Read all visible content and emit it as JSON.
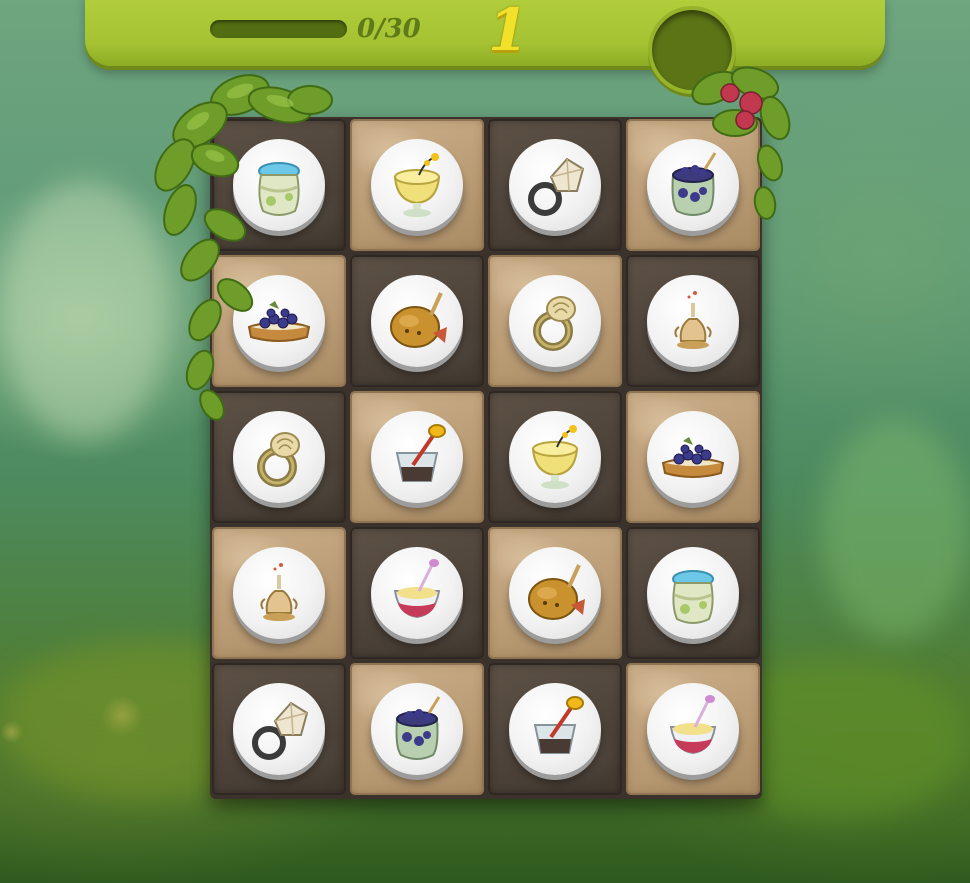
{
  "hud": {
    "progress_current": 0,
    "progress_total": 30,
    "progress_text": "0/30",
    "level": "1"
  },
  "colors": {
    "hud_green": "#a4c232",
    "level_yellow": "#f2e12a",
    "tile_light": "#b89a73",
    "tile_dark": "#4c4239"
  },
  "board": {
    "columns": 4,
    "rows": 5,
    "tiles": [
      {
        "row": 0,
        "col": 0,
        "shade": "dark",
        "item": "blue-lidded-jar"
      },
      {
        "row": 0,
        "col": 1,
        "shade": "light",
        "item": "lemon-dessert-cup"
      },
      {
        "row": 0,
        "col": 2,
        "shade": "dark",
        "item": "diamond-ring"
      },
      {
        "row": 0,
        "col": 3,
        "shade": "light",
        "item": "blueberry-jar"
      },
      {
        "row": 1,
        "col": 0,
        "shade": "light",
        "item": "blueberry-toast"
      },
      {
        "row": 1,
        "col": 1,
        "shade": "dark",
        "item": "roast-chicken"
      },
      {
        "row": 1,
        "col": 2,
        "shade": "light",
        "item": "gold-rose-ring"
      },
      {
        "row": 1,
        "col": 3,
        "shade": "dark",
        "item": "perfume-decanter"
      },
      {
        "row": 2,
        "col": 0,
        "shade": "dark",
        "item": "gold-rose-ring"
      },
      {
        "row": 2,
        "col": 1,
        "shade": "light",
        "item": "honey-dipper-glass"
      },
      {
        "row": 2,
        "col": 2,
        "shade": "dark",
        "item": "lemon-dessert-cup"
      },
      {
        "row": 2,
        "col": 3,
        "shade": "light",
        "item": "blueberry-toast"
      },
      {
        "row": 3,
        "col": 0,
        "shade": "light",
        "item": "perfume-decanter"
      },
      {
        "row": 3,
        "col": 1,
        "shade": "dark",
        "item": "berry-parfait"
      },
      {
        "row": 3,
        "col": 2,
        "shade": "light",
        "item": "roast-chicken"
      },
      {
        "row": 3,
        "col": 3,
        "shade": "dark",
        "item": "blue-lidded-jar"
      },
      {
        "row": 4,
        "col": 0,
        "shade": "dark",
        "item": "diamond-ring"
      },
      {
        "row": 4,
        "col": 1,
        "shade": "light",
        "item": "blueberry-jar"
      },
      {
        "row": 4,
        "col": 2,
        "shade": "dark",
        "item": "honey-dipper-glass"
      },
      {
        "row": 4,
        "col": 3,
        "shade": "light",
        "item": "berry-parfait"
      }
    ]
  }
}
